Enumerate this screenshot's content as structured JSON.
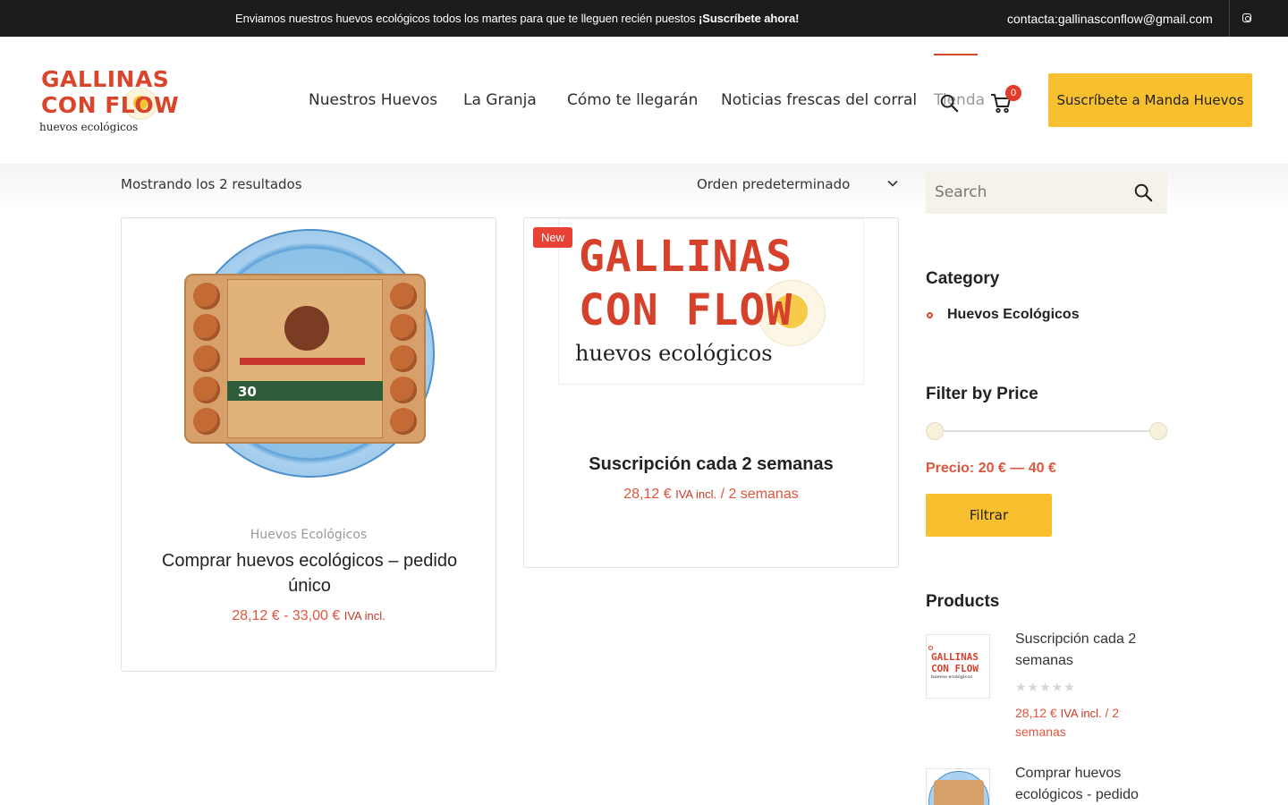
{
  "topbar": {
    "promo": "Enviamos nuestros huevos ecológicos todos los martes para que te lleguen recién puestos",
    "promo_cta": "¡Suscríbete ahora!",
    "email": "contacta:gallinasconflow@gmail.com",
    "social_icon": "instagram-icon"
  },
  "brand": {
    "line1": "GALLINAS",
    "line2": "CON FLOW",
    "tagline": "huevos ecológicos"
  },
  "nav": {
    "items": [
      "Nuestros Huevos",
      "La Granja",
      "Cómo te llegarán",
      "Noticias frescas del corral",
      "Tienda"
    ],
    "active": "Tienda",
    "cart_count": "0",
    "cta": "Suscríbete a Manda Huevos"
  },
  "shop": {
    "results": "Mostrando los 2 resultados",
    "sort": "Orden predeterminado"
  },
  "products": [
    {
      "category": "Huevos Ecológicos",
      "title": "Comprar huevos ecológicos – pedido único",
      "price": "28,12 € - 33,00 €",
      "tax": "IVA incl.",
      "carton_count": "30"
    },
    {
      "badge": "New",
      "title": "Suscripción cada 2 semanas",
      "price": "28,12 €",
      "tax": "IVA incl.",
      "period": " / 2 semanas"
    }
  ],
  "sidebar": {
    "search_placeholder": "Search",
    "category_title": "Category",
    "categories": [
      "Huevos Ecológicos"
    ],
    "filter_title": "Filter by Price",
    "price_range": "Precio: 20 € — 40 €",
    "filter_button": "Filtrar",
    "products_title": "Products",
    "products": [
      {
        "name": "Suscripción cada 2 semanas",
        "stars": "★★★★★",
        "price": "28,12 €",
        "tax": "IVA incl.",
        "period": " / 2 semanas"
      },
      {
        "name": "Comprar huevos ecológicos - pedido"
      }
    ]
  },
  "colors": {
    "accent": "#d9452b",
    "button": "#f8c02f",
    "topbar": "#1c1c1c",
    "price": "#e0553c"
  }
}
